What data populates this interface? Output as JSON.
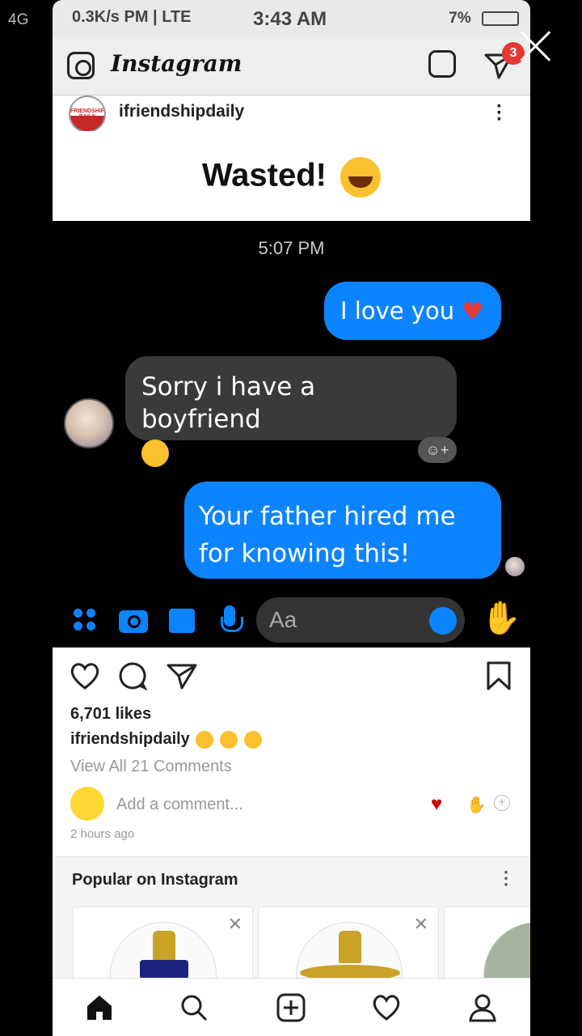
{
  "outer_status": {
    "network": "4G",
    "time": "3:43 AM",
    "battery": "7%"
  },
  "inner_status": {
    "left": "0.3K/s PM | LTE",
    "right": ""
  },
  "app": {
    "title": "Instagram",
    "dm_badge": "3"
  },
  "post": {
    "username": "ifriendshipdaily",
    "avatar_text": "FRIENDSHIP DAILY",
    "caption_title": "Wasted!"
  },
  "chat": {
    "time": "5:07 PM",
    "messages": [
      {
        "from": "me",
        "text": "I love you"
      },
      {
        "from": "them",
        "text": "Sorry i have a boyfriend"
      },
      {
        "from": "me",
        "text": "Your father hired me for knowing this!"
      }
    ],
    "react_label": "☺+",
    "input_placeholder": "Aa"
  },
  "feed": {
    "likes": "6,701 likes",
    "caption_user": "ifriendshipdaily",
    "view_comments": "View All 21 Comments",
    "add_comment_placeholder": "Add a comment...",
    "time_ago": "2 hours ago",
    "popular_title": "Popular on Instagram"
  },
  "colors": {
    "sent_bubble": "#0d84ff",
    "received_bubble": "#3a3a3a",
    "badge": "#e53935"
  }
}
